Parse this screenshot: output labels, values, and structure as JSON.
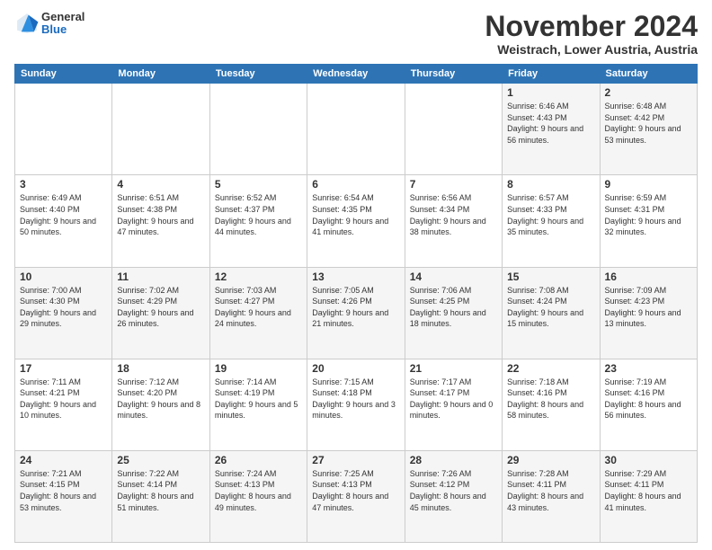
{
  "header": {
    "logo": {
      "general": "General",
      "blue": "Blue"
    },
    "title": "November 2024",
    "location": "Weistrach, Lower Austria, Austria"
  },
  "days_header": [
    "Sunday",
    "Monday",
    "Tuesday",
    "Wednesday",
    "Thursday",
    "Friday",
    "Saturday"
  ],
  "weeks": [
    [
      {
        "day": "",
        "info": ""
      },
      {
        "day": "",
        "info": ""
      },
      {
        "day": "",
        "info": ""
      },
      {
        "day": "",
        "info": ""
      },
      {
        "day": "",
        "info": ""
      },
      {
        "day": "1",
        "info": "Sunrise: 6:46 AM\nSunset: 4:43 PM\nDaylight: 9 hours\nand 56 minutes."
      },
      {
        "day": "2",
        "info": "Sunrise: 6:48 AM\nSunset: 4:42 PM\nDaylight: 9 hours\nand 53 minutes."
      }
    ],
    [
      {
        "day": "3",
        "info": "Sunrise: 6:49 AM\nSunset: 4:40 PM\nDaylight: 9 hours\nand 50 minutes."
      },
      {
        "day": "4",
        "info": "Sunrise: 6:51 AM\nSunset: 4:38 PM\nDaylight: 9 hours\nand 47 minutes."
      },
      {
        "day": "5",
        "info": "Sunrise: 6:52 AM\nSunset: 4:37 PM\nDaylight: 9 hours\nand 44 minutes."
      },
      {
        "day": "6",
        "info": "Sunrise: 6:54 AM\nSunset: 4:35 PM\nDaylight: 9 hours\nand 41 minutes."
      },
      {
        "day": "7",
        "info": "Sunrise: 6:56 AM\nSunset: 4:34 PM\nDaylight: 9 hours\nand 38 minutes."
      },
      {
        "day": "8",
        "info": "Sunrise: 6:57 AM\nSunset: 4:33 PM\nDaylight: 9 hours\nand 35 minutes."
      },
      {
        "day": "9",
        "info": "Sunrise: 6:59 AM\nSunset: 4:31 PM\nDaylight: 9 hours\nand 32 minutes."
      }
    ],
    [
      {
        "day": "10",
        "info": "Sunrise: 7:00 AM\nSunset: 4:30 PM\nDaylight: 9 hours\nand 29 minutes."
      },
      {
        "day": "11",
        "info": "Sunrise: 7:02 AM\nSunset: 4:29 PM\nDaylight: 9 hours\nand 26 minutes."
      },
      {
        "day": "12",
        "info": "Sunrise: 7:03 AM\nSunset: 4:27 PM\nDaylight: 9 hours\nand 24 minutes."
      },
      {
        "day": "13",
        "info": "Sunrise: 7:05 AM\nSunset: 4:26 PM\nDaylight: 9 hours\nand 21 minutes."
      },
      {
        "day": "14",
        "info": "Sunrise: 7:06 AM\nSunset: 4:25 PM\nDaylight: 9 hours\nand 18 minutes."
      },
      {
        "day": "15",
        "info": "Sunrise: 7:08 AM\nSunset: 4:24 PM\nDaylight: 9 hours\nand 15 minutes."
      },
      {
        "day": "16",
        "info": "Sunrise: 7:09 AM\nSunset: 4:23 PM\nDaylight: 9 hours\nand 13 minutes."
      }
    ],
    [
      {
        "day": "17",
        "info": "Sunrise: 7:11 AM\nSunset: 4:21 PM\nDaylight: 9 hours\nand 10 minutes."
      },
      {
        "day": "18",
        "info": "Sunrise: 7:12 AM\nSunset: 4:20 PM\nDaylight: 9 hours\nand 8 minutes."
      },
      {
        "day": "19",
        "info": "Sunrise: 7:14 AM\nSunset: 4:19 PM\nDaylight: 9 hours\nand 5 minutes."
      },
      {
        "day": "20",
        "info": "Sunrise: 7:15 AM\nSunset: 4:18 PM\nDaylight: 9 hours\nand 3 minutes."
      },
      {
        "day": "21",
        "info": "Sunrise: 7:17 AM\nSunset: 4:17 PM\nDaylight: 9 hours\nand 0 minutes."
      },
      {
        "day": "22",
        "info": "Sunrise: 7:18 AM\nSunset: 4:16 PM\nDaylight: 8 hours\nand 58 minutes."
      },
      {
        "day": "23",
        "info": "Sunrise: 7:19 AM\nSunset: 4:16 PM\nDaylight: 8 hours\nand 56 minutes."
      }
    ],
    [
      {
        "day": "24",
        "info": "Sunrise: 7:21 AM\nSunset: 4:15 PM\nDaylight: 8 hours\nand 53 minutes."
      },
      {
        "day": "25",
        "info": "Sunrise: 7:22 AM\nSunset: 4:14 PM\nDaylight: 8 hours\nand 51 minutes."
      },
      {
        "day": "26",
        "info": "Sunrise: 7:24 AM\nSunset: 4:13 PM\nDaylight: 8 hours\nand 49 minutes."
      },
      {
        "day": "27",
        "info": "Sunrise: 7:25 AM\nSunset: 4:13 PM\nDaylight: 8 hours\nand 47 minutes."
      },
      {
        "day": "28",
        "info": "Sunrise: 7:26 AM\nSunset: 4:12 PM\nDaylight: 8 hours\nand 45 minutes."
      },
      {
        "day": "29",
        "info": "Sunrise: 7:28 AM\nSunset: 4:11 PM\nDaylight: 8 hours\nand 43 minutes."
      },
      {
        "day": "30",
        "info": "Sunrise: 7:29 AM\nSunset: 4:11 PM\nDaylight: 8 hours\nand 41 minutes."
      }
    ]
  ]
}
